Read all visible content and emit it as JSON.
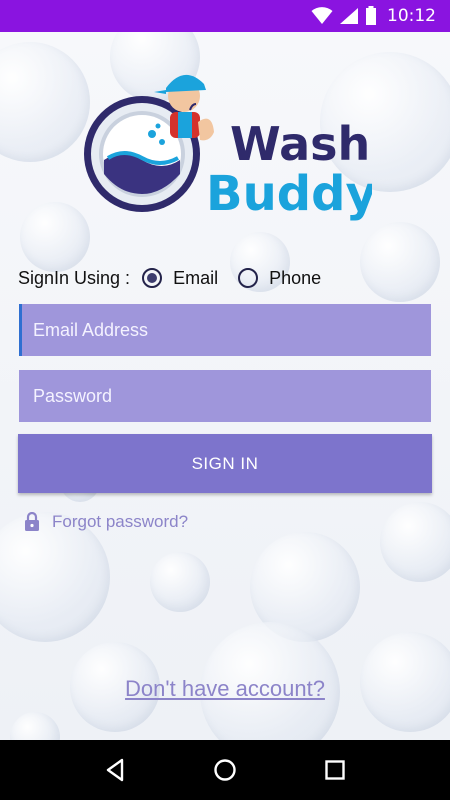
{
  "status_bar": {
    "time": "10:12",
    "icons": [
      "wifi-icon",
      "signal-icon",
      "battery-icon"
    ],
    "color": "#8a14e0"
  },
  "logo": {
    "line1": "Wash",
    "line2": "Buddy"
  },
  "signin": {
    "label": "SignIn Using :",
    "options": [
      {
        "label": "Email",
        "selected": true
      },
      {
        "label": "Phone",
        "selected": false
      }
    ]
  },
  "form": {
    "email_placeholder": "Email Address",
    "email_value": "",
    "password_placeholder": "Password",
    "password_value": "",
    "signin_label": "SIGN IN",
    "forgot_label": "Forgot password?",
    "no_account_label": "Don't have account?"
  },
  "colors": {
    "field": "#9f96db",
    "button": "#7d74cc",
    "link": "#8c84c9",
    "logo_dark": "#2f2a6b",
    "logo_blue": "#1ba3dc"
  },
  "nav": {
    "icons": [
      "back-icon",
      "home-icon",
      "recents-icon"
    ]
  }
}
